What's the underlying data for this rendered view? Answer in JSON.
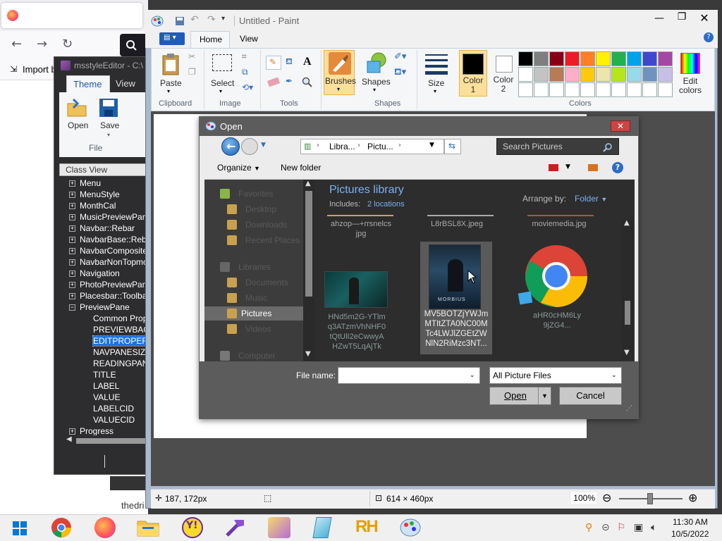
{
  "browser": {
    "bookmark_label": "Import b",
    "bottom_text": "thedri"
  },
  "msstyle": {
    "title": "msstyleEditor - C:\\",
    "tabs": [
      "Theme",
      "View"
    ],
    "open_label": "Open",
    "save_label": "Save",
    "group_label": "File",
    "classview_label": "Class View",
    "tree": [
      {
        "label": "Menu",
        "expand": "+",
        "indent": 0
      },
      {
        "label": "MenuStyle",
        "expand": "+",
        "indent": 0
      },
      {
        "label": "MonthCal",
        "expand": "+",
        "indent": 0
      },
      {
        "label": "MusicPreviewPane",
        "expand": "+",
        "indent": 0
      },
      {
        "label": "Navbar::Rebar",
        "expand": "+",
        "indent": 0
      },
      {
        "label": "NavbarBase::Reba",
        "expand": "+",
        "indent": 0
      },
      {
        "label": "NavbarComposited",
        "expand": "+",
        "indent": 0
      },
      {
        "label": "NavbarNonTopmos",
        "expand": "+",
        "indent": 0
      },
      {
        "label": "Navigation",
        "expand": "+",
        "indent": 0
      },
      {
        "label": "PhotoPreviewPane",
        "expand": "+",
        "indent": 0
      },
      {
        "label": "Placesbar::Toolbar",
        "expand": "+",
        "indent": 0
      },
      {
        "label": "PreviewPane",
        "expand": "−",
        "indent": 0
      },
      {
        "label": "Common Prope",
        "expand": "",
        "indent": 1
      },
      {
        "label": "PREVIEWBAC",
        "expand": "",
        "indent": 1
      },
      {
        "label": "EDITPROPER",
        "expand": "",
        "indent": 1,
        "selected": true
      },
      {
        "label": "NAVPANESIZE",
        "expand": "",
        "indent": 1
      },
      {
        "label": "READINGPAN",
        "expand": "",
        "indent": 1
      },
      {
        "label": "TITLE",
        "expand": "",
        "indent": 1
      },
      {
        "label": "LABEL",
        "expand": "",
        "indent": 1
      },
      {
        "label": "VALUE",
        "expand": "",
        "indent": 1
      },
      {
        "label": "LABELCID",
        "expand": "",
        "indent": 1
      },
      {
        "label": "VALUECID",
        "expand": "",
        "indent": 1
      },
      {
        "label": "Progress",
        "expand": "+",
        "indent": 0
      }
    ]
  },
  "paint": {
    "title": "Untitled - Paint",
    "tabs": [
      "Home",
      "View"
    ],
    "buttons": {
      "paste": "Paste",
      "select": "Select",
      "brushes": "Brushes",
      "shapes": "Shapes",
      "size": "Size",
      "color1": "Color\n1",
      "color2": "Color\n2",
      "edit_colors": "Edit\ncolors"
    },
    "groups": [
      "Clipboard",
      "Image",
      "Tools",
      "Shapes",
      "Colors"
    ],
    "palette": [
      "#000000",
      "#7f7f7f",
      "#880015",
      "#ed1c24",
      "#ff7f27",
      "#fff200",
      "#22b14c",
      "#00a2e8",
      "#3f48cc",
      "#a349a4",
      "#ffffff",
      "#c3c3c3",
      "#b97a57",
      "#ffaec9",
      "#ffc90e",
      "#efe4b0",
      "#b5e61d",
      "#99d9ea",
      "#7092be",
      "#c8bfe7",
      "#ffffff",
      "#ffffff",
      "#ffffff",
      "#ffffff",
      "#ffffff",
      "#ffffff",
      "#ffffff",
      "#ffffff",
      "#ffffff",
      "#ffffff"
    ],
    "status": {
      "cursor_pos": "187, 172px",
      "canvas_size": "614 × 460px",
      "zoom": "100%"
    }
  },
  "dialog": {
    "title": "Open",
    "breadcrumb": [
      "Libra...",
      "Pictu..."
    ],
    "search_placeholder": "Search Pictures",
    "organize": "Organize",
    "new_folder": "New folder",
    "library_title": "Pictures library",
    "includes_label": "Includes:",
    "includes_link": "2 locations",
    "arrange_label": "Arrange by:",
    "arrange_value": "Folder",
    "nav_items": [
      {
        "label": "Favorites",
        "icon": "star-icon"
      },
      {
        "label": "Desktop",
        "icon": "desktop-icon"
      },
      {
        "label": "Downloads",
        "icon": "downloads-icon"
      },
      {
        "label": "Recent Places",
        "icon": "recent-icon"
      },
      {
        "label": "Libraries",
        "icon": "libraries-icon"
      },
      {
        "label": "Documents",
        "icon": "documents-icon"
      },
      {
        "label": "Music",
        "icon": "music-icon"
      },
      {
        "label": "Pictures",
        "icon": "pictures-icon",
        "selected": true
      },
      {
        "label": "Videos",
        "icon": "videos-icon"
      },
      {
        "label": "Computer",
        "icon": "computer-icon"
      }
    ],
    "top_files": [
      "ahzop—+rrsnelcs\njpg",
      "L8rBSL8X.jpeg",
      "moviemedia.jpg"
    ],
    "files": [
      {
        "name": "HNd5m2G-YTlm\nq3ATzmVhNHF0\ntQtUlI2eCwwyA\nHZwT5LqAjTk",
        "thumb": "dark-teal-thumbnail"
      },
      {
        "name": "MV5BOTZjYWJm\nMTItZTA0NC00M\nTc4LWJlZGEtZW\nNlN2RiMzc3NT...",
        "thumb": "morbius-poster-thumbnail",
        "selected": true
      },
      {
        "name": "aHR0cHM6Ly\n9jZG4...",
        "thumb": "chrome-logo-thumbnail"
      }
    ],
    "filename_label": "File name:",
    "filename_value": "",
    "filetype": "All Picture Files",
    "open_label": "Open",
    "cancel_label": "Cancel"
  },
  "taskbar": {
    "time": "11:30 AM",
    "date": "10/5/2022",
    "apps": [
      "windows-start",
      "chrome",
      "firefox",
      "file-explorer",
      "yahoo-messenger",
      "app-hammer",
      "app-painter",
      "app-glass",
      "app-rh",
      "paint"
    ]
  }
}
